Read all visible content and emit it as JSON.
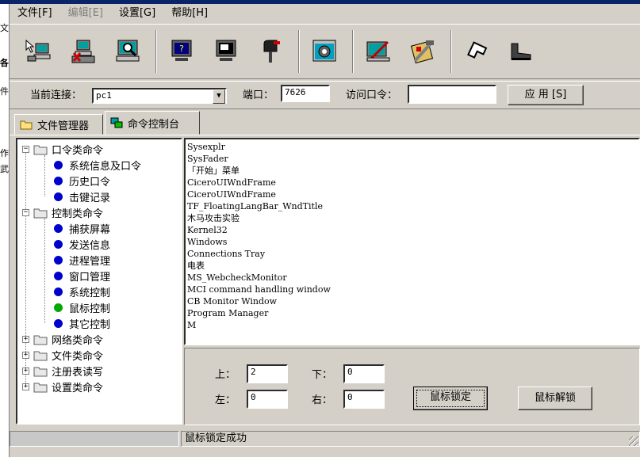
{
  "menu": [
    {
      "label": "文件[F]",
      "disabled": false
    },
    {
      "label": "编辑[E]",
      "disabled": true
    },
    {
      "label": "设置[G]",
      "disabled": false
    },
    {
      "label": "帮助[H]",
      "disabled": false
    }
  ],
  "toolbar_icons": [
    "connect-icon",
    "disconnect-icon",
    "search-computer-icon",
    "help-monitor-icon",
    "screen-icon",
    "mailbox-icon",
    "settings-gear-icon",
    "edit-screen-icon",
    "tools-icon",
    "home-icon",
    "boot-icon"
  ],
  "connection": {
    "label": "当前连接：",
    "value": "pc1",
    "port_label": "端口：",
    "port_value": "7626",
    "password_label": "访问口令：",
    "password_value": "",
    "apply_label": "应 用 [S]"
  },
  "tabs": [
    {
      "label": "文件管理器",
      "active": false
    },
    {
      "label": "命令控制台",
      "active": true
    }
  ],
  "tree": {
    "groups": [
      {
        "label": "口令类命令",
        "expanded": true,
        "children": [
          "系统信息及口令",
          "历史口令",
          "击键记录"
        ]
      },
      {
        "label": "控制类命令",
        "expanded": true,
        "children": [
          "捕获屏幕",
          "发送信息",
          "进程管理",
          "窗口管理",
          "系统控制",
          "鼠标控制",
          "其它控制"
        ]
      },
      {
        "label": "网络类命令",
        "expanded": false,
        "children": []
      },
      {
        "label": "文件类命令",
        "expanded": false,
        "children": []
      },
      {
        "label": "注册表读写",
        "expanded": false,
        "children": []
      },
      {
        "label": "设置类命令",
        "expanded": false,
        "children": []
      }
    ],
    "selected": "鼠标控制"
  },
  "window_list": [
    "Sysexplr",
    "SysFader",
    "「开始」菜单",
    "CiceroUIWndFrame",
    "CiceroUIWndFrame",
    "TF_FloatingLangBar_WndTitle",
    "木马攻击实验",
    "Kernel32",
    "Windows",
    "Connections Tray",
    "电表",
    "MS_WebcheckMonitor",
    "MCI command handling window",
    "CB Monitor Window",
    "Program Manager",
    "M"
  ],
  "mouse": {
    "top_label": "上：",
    "top_value": "2",
    "bottom_label": "下：",
    "bottom_value": "0",
    "left_label": "左：",
    "left_value": "0",
    "right_label": "右：",
    "right_value": "0",
    "lock_label": "鼠标锁定",
    "unlock_label": "鼠标解锁"
  },
  "status": {
    "message": "鼠标锁定成功"
  },
  "peek_text": [
    "文",
    "各",
    "件",
    "作",
    "武"
  ],
  "colors": {
    "face": "#d4d0c8",
    "titlebar": "#0a246a",
    "dot_blue": "#0000cc",
    "dot_green": "#00aa00"
  }
}
